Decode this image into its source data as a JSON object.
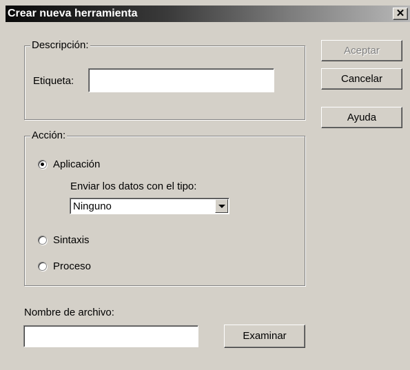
{
  "window": {
    "title": "Crear nueva herramienta",
    "close_glyph": "✕"
  },
  "descripcion": {
    "legend": "Descripción:",
    "label": "Etiqueta:",
    "value": ""
  },
  "accion": {
    "legend": "Acción:",
    "options": [
      {
        "label": "Aplicación",
        "selected": true
      },
      {
        "label": "Sintaxis",
        "selected": false
      },
      {
        "label": "Proceso",
        "selected": false
      }
    ],
    "send_label": "Enviar los datos con el tipo:",
    "send_value": "Ninguno"
  },
  "archivo": {
    "label": "Nombre de archivo:",
    "value": "",
    "browse": "Examinar"
  },
  "buttons": {
    "accept": "Aceptar",
    "cancel": "Cancelar",
    "help": "Ayuda"
  }
}
